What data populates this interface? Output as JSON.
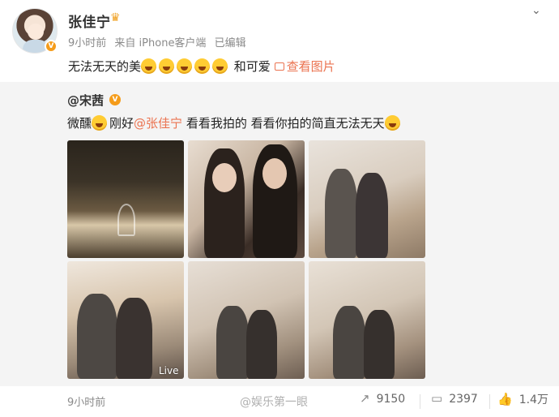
{
  "post": {
    "author": "张佳宁",
    "meta": {
      "time": "9小时前",
      "source": "来自 iPhone客户端",
      "edited": "已编辑"
    },
    "text_prefix": "无法无天的美",
    "text_suffix": "和可爱",
    "view_pictures": "查看图片",
    "emoji_count": 5
  },
  "repost": {
    "author": "@宋茜",
    "text_prefix": "微醺",
    "text_mid": "刚好",
    "mention": "@张佳宁",
    "text_suffix": " 看看我拍的 看看你拍的简直无法无天",
    "live_label": "Live"
  },
  "footer": {
    "time": "9小时前",
    "watermark": "@娱乐第一眼",
    "shares": "9150",
    "comments": "2397",
    "likes": "1.4万"
  },
  "colors": {
    "accent": "#eb7350",
    "verified": "#f59c1a",
    "repost_bg": "#f4f4f4"
  },
  "icons": {
    "verified": "verified-badge-icon",
    "crown": "crown-icon",
    "dropdown": "chevron-down-icon",
    "picture": "picture-icon",
    "share": "share-icon",
    "comment": "comment-icon",
    "like": "thumbs-up-icon"
  }
}
